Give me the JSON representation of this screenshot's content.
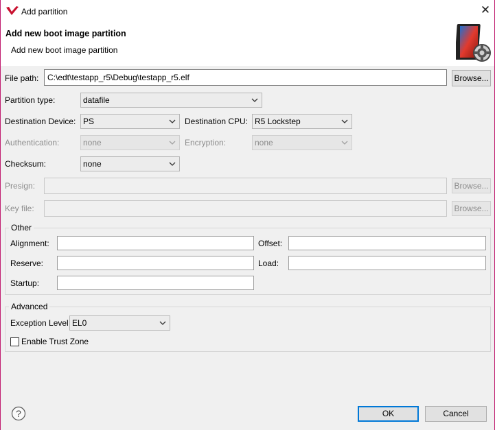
{
  "window": {
    "title": "Add partition",
    "close_symbol": "✕"
  },
  "header": {
    "title": "Add new boot image partition",
    "subtitle": "Add new boot image partition"
  },
  "file_path": {
    "label": "File path:",
    "value": "C:\\edt\\testapp_r5\\Debug\\testapp_r5.elf",
    "browse": "Browse..."
  },
  "partition_type": {
    "label": "Partition type:",
    "value": "datafile"
  },
  "destination_device": {
    "label": "Destination Device:",
    "value": "PS"
  },
  "destination_cpu": {
    "label": "Destination CPU:",
    "value": "R5 Lockstep"
  },
  "authentication": {
    "label": "Authentication:",
    "value": "none"
  },
  "encryption": {
    "label": "Encryption:",
    "value": "none"
  },
  "checksum": {
    "label": "Checksum:",
    "value": "none"
  },
  "presign": {
    "label": "Presign:",
    "value": "",
    "browse": "Browse..."
  },
  "key_file": {
    "label": "Key file:",
    "value": "",
    "browse": "Browse..."
  },
  "other": {
    "title": "Other",
    "alignment_label": "Alignment:",
    "offset_label": "Offset:",
    "reserve_label": "Reserve:",
    "load_label": "Load:",
    "startup_label": "Startup:"
  },
  "advanced": {
    "title": "Advanced",
    "exception_level_label": "Exception Level",
    "exception_level_value": "EL0",
    "trust_zone_label": "Enable Trust Zone"
  },
  "footer": {
    "help_symbol": "?",
    "ok": "OK",
    "cancel": "Cancel"
  }
}
